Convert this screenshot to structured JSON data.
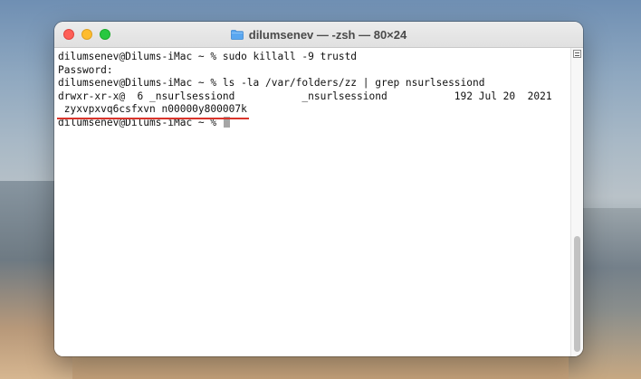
{
  "window": {
    "title": "dilumsenev — -zsh — 80×24"
  },
  "terminal": {
    "lines": [
      "dilumsenev@Dilums-iMac ~ % sudo killall -9 trustd",
      "Password:",
      "dilumsenev@Dilums-iMac ~ % ls -la /var/folders/zz | grep nsurlsessiond",
      "drwxr-xr-x@  6 _nsurlsessiond           _nsurlsessiond           192 Jul 20  2021"
    ],
    "highlighted_line": " zyxvpxvq6csfxvn n00000y800007k",
    "prompt": "dilumsenev@Dilums-iMac ~ % "
  },
  "colors": {
    "annotation_underline": "#d9342b",
    "close": "#fe5f57",
    "minimize": "#febc2e",
    "zoom": "#28c840",
    "folder_icon": "#5aa7f0"
  },
  "icons": {
    "title_icon": "folder-icon",
    "scroll_button": "hamburger-icon"
  }
}
